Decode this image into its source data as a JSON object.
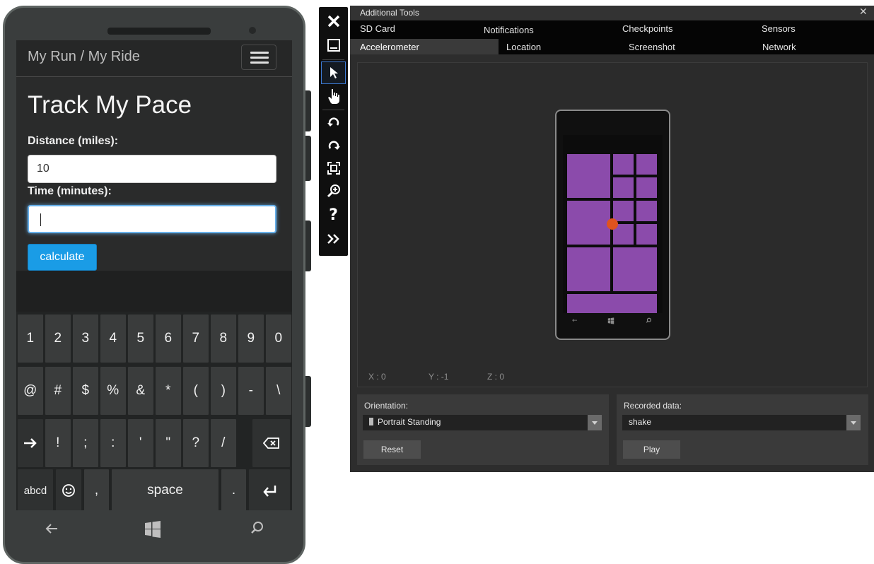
{
  "phone": {
    "app_title": "My Run / My Ride",
    "page_heading": "Track My Pace",
    "distance_label": "Distance (miles):",
    "distance_value": "10",
    "time_label": "Time (minutes):",
    "time_value": "",
    "calculate_label": "calculate",
    "keyboard": {
      "row1": [
        "1",
        "2",
        "3",
        "4",
        "5",
        "6",
        "7",
        "8",
        "9",
        "0"
      ],
      "row2": [
        "@",
        "#",
        "$",
        "%",
        "&",
        "*",
        "(",
        ")",
        "-",
        "\\"
      ],
      "row3": [
        "!",
        ";",
        ":",
        "'",
        "\"",
        "?",
        "/"
      ],
      "mode_label": "abcd",
      "comma_label": ",",
      "space_label": "space",
      "period_label": "."
    }
  },
  "toolbar": {
    "buttons": [
      "close",
      "minimize",
      "select",
      "touch",
      "rotate-left",
      "rotate-right",
      "fit-to-screen",
      "zoom",
      "help",
      "tools"
    ]
  },
  "tools": {
    "window_title": "Additional Tools",
    "close_glyph": "✕",
    "tabs_row1": [
      "SD Card",
      "Notifications",
      "Checkpoints",
      "Sensors"
    ],
    "tabs_row2": [
      "Accelerometer",
      "Location",
      "Screenshot",
      "Network"
    ],
    "selected_tab": "Accelerometer",
    "accelerometer": {
      "x_readout": "X : 0",
      "y_readout": "Y : -1",
      "z_readout": "Z : 0"
    },
    "orientation_label": "Orientation:",
    "orientation_value": "Portrait Standing",
    "reset_label": "Reset",
    "recorded_label": "Recorded data:",
    "recorded_value": "shake",
    "play_label": "Play"
  },
  "colors": {
    "accent_blue": "#1a9ce6",
    "tile_purple": "#8b4bab",
    "dot_orange": "#e0531e"
  }
}
